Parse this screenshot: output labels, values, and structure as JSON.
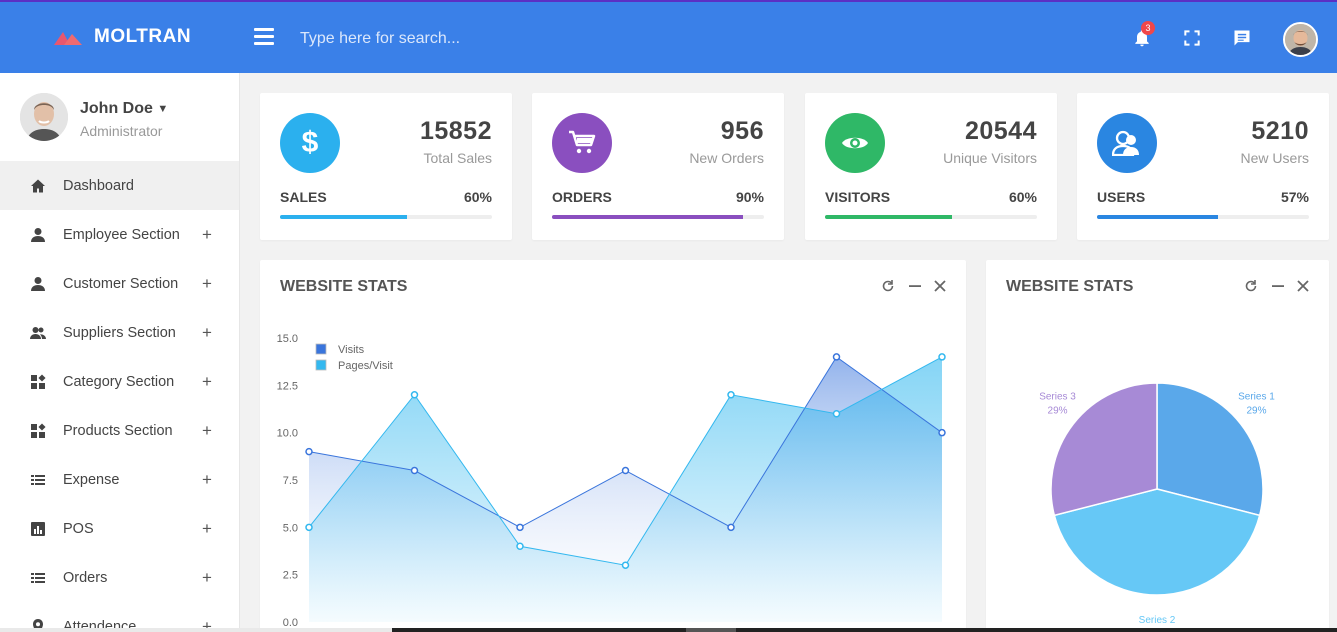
{
  "brand": {
    "name": "MOLTRAN",
    "logo_icon": "mountain-logo-icon"
  },
  "search": {
    "placeholder": "Type here for search..."
  },
  "topbar": {
    "notification_count": "3",
    "icons": [
      "bell-icon",
      "fullscreen-icon",
      "chat-icon",
      "avatar"
    ]
  },
  "profile": {
    "name": "John Doe",
    "role": "Administrator"
  },
  "sidebar": {
    "items": [
      {
        "label": "Dashboard",
        "icon": "home-icon",
        "expandable": false
      },
      {
        "label": "Employee Section",
        "icon": "person-icon",
        "expandable": true
      },
      {
        "label": "Customer Section",
        "icon": "person-icon",
        "expandable": true
      },
      {
        "label": "Suppliers Section",
        "icon": "people-icon",
        "expandable": true
      },
      {
        "label": "Category Section",
        "icon": "widgets-icon",
        "expandable": true
      },
      {
        "label": "Products Section",
        "icon": "widgets-icon",
        "expandable": true
      },
      {
        "label": "Expense",
        "icon": "list-icon",
        "expandable": true
      },
      {
        "label": "POS",
        "icon": "chart-icon",
        "expandable": true
      },
      {
        "label": "Orders",
        "icon": "list-icon",
        "expandable": true
      },
      {
        "label": "Attendence",
        "icon": "location-icon",
        "expandable": true
      }
    ],
    "plus": "+"
  },
  "stats": [
    {
      "value": "15852",
      "label": "Total Sales",
      "category": "SALES",
      "percent": "60%",
      "progress": 0.6,
      "color": "#2bb0ee",
      "icon": "dollar-icon"
    },
    {
      "value": "956",
      "label": "New Orders",
      "category": "ORDERS",
      "percent": "90%",
      "progress": 0.9,
      "color": "#8a4fbf",
      "icon": "cart-icon"
    },
    {
      "value": "20544",
      "label": "Unique Visitors",
      "category": "VISITORS",
      "percent": "60%",
      "progress": 0.6,
      "color": "#2fb867",
      "icon": "eye-icon"
    },
    {
      "value": "5210",
      "label": "New Users",
      "category": "USERS",
      "percent": "57%",
      "progress": 0.57,
      "color": "#2a86e1",
      "icon": "users-icon"
    }
  ],
  "panels": {
    "area_title": "WEBSITE STATS",
    "pie_title": "WEBSITE STATS"
  },
  "chart_data": [
    {
      "type": "area",
      "title": "WEBSITE STATS",
      "ylim": [
        0,
        15
      ],
      "yticks": [
        "15.0",
        "12.5",
        "10.0",
        "7.5",
        "5.0",
        "2.5",
        "0.0"
      ],
      "legend_position": "top-left",
      "x": [
        1,
        2,
        3,
        4,
        5,
        6,
        7
      ],
      "series": [
        {
          "name": "Visits",
          "values": [
            9,
            8,
            5,
            8,
            5,
            14,
            10
          ],
          "color": "#3a75dc"
        },
        {
          "name": "Pages/Visit",
          "values": [
            5,
            12,
            4,
            3,
            12,
            11,
            14
          ],
          "color": "#33b8ef"
        }
      ]
    },
    {
      "type": "pie",
      "title": "WEBSITE STATS",
      "slices": [
        {
          "name": "Series 1",
          "label": "29%",
          "value": 29,
          "color": "#5aa8ea"
        },
        {
          "name": "Series 2",
          "label": "",
          "value": 42,
          "color": "#66c8f6"
        },
        {
          "name": "Series 3",
          "label": "29%",
          "value": 29,
          "color": "#a78ad6"
        }
      ]
    }
  ]
}
